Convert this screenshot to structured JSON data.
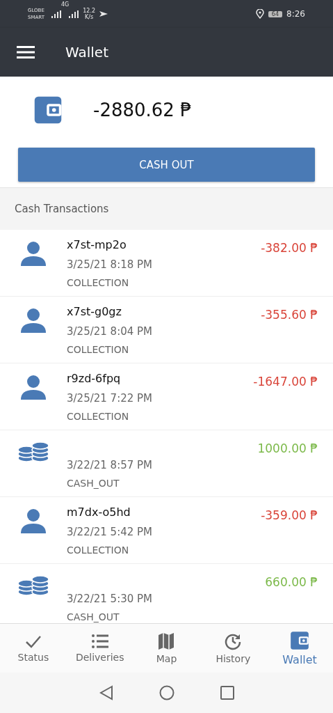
{
  "status_bar": {
    "carrier_1": "GLOBE",
    "carrier_2": "SMART",
    "network": "4G",
    "speed": "12.2",
    "speed_unit": "K/s",
    "battery": "64",
    "time": "8:26"
  },
  "app_bar": {
    "title": "Wallet"
  },
  "balance": {
    "amount": "-2880.62 ₱",
    "button": "CASH OUT"
  },
  "section_title": "Cash Transactions",
  "transactions": [
    {
      "kind": "collection",
      "name": "x7st-mp2o",
      "amount": "-382.00 ₱",
      "color": "#d9453a",
      "date": "3/25/21 8:18 PM",
      "type": "COLLECTION"
    },
    {
      "kind": "collection",
      "name": "x7st-g0gz",
      "amount": "-355.60 ₱",
      "color": "#d9453a",
      "date": "3/25/21 8:04 PM",
      "type": "COLLECTION"
    },
    {
      "kind": "collection",
      "name": "r9zd-6fpq",
      "amount": "-1647.00 ₱",
      "color": "#d9453a",
      "date": "3/25/21 7:22 PM",
      "type": "COLLECTION"
    },
    {
      "kind": "cash_out",
      "amount": "1000.00 ₱",
      "color": "#7cb94a",
      "date": "3/22/21 8:57 PM",
      "type": "CASH_OUT"
    },
    {
      "kind": "collection",
      "name": "m7dx-o5hd",
      "amount": "-359.00 ₱",
      "color": "#d9453a",
      "date": "3/22/21 5:42 PM",
      "type": "COLLECTION"
    },
    {
      "kind": "cash_out",
      "amount": "660.00 ₱",
      "color": "#7cb94a",
      "date": "3/22/21 5:30 PM",
      "type": "CASH_OUT"
    }
  ],
  "bottom_nav": [
    {
      "kind": "status",
      "label": "Status",
      "selected": false
    },
    {
      "kind": "deliveries",
      "label": "Deliveries",
      "selected": false
    },
    {
      "kind": "map",
      "label": "Map",
      "selected": false
    },
    {
      "kind": "history",
      "label": "History",
      "selected": false
    },
    {
      "kind": "wallet",
      "label": "Wallet",
      "selected": true
    }
  ]
}
